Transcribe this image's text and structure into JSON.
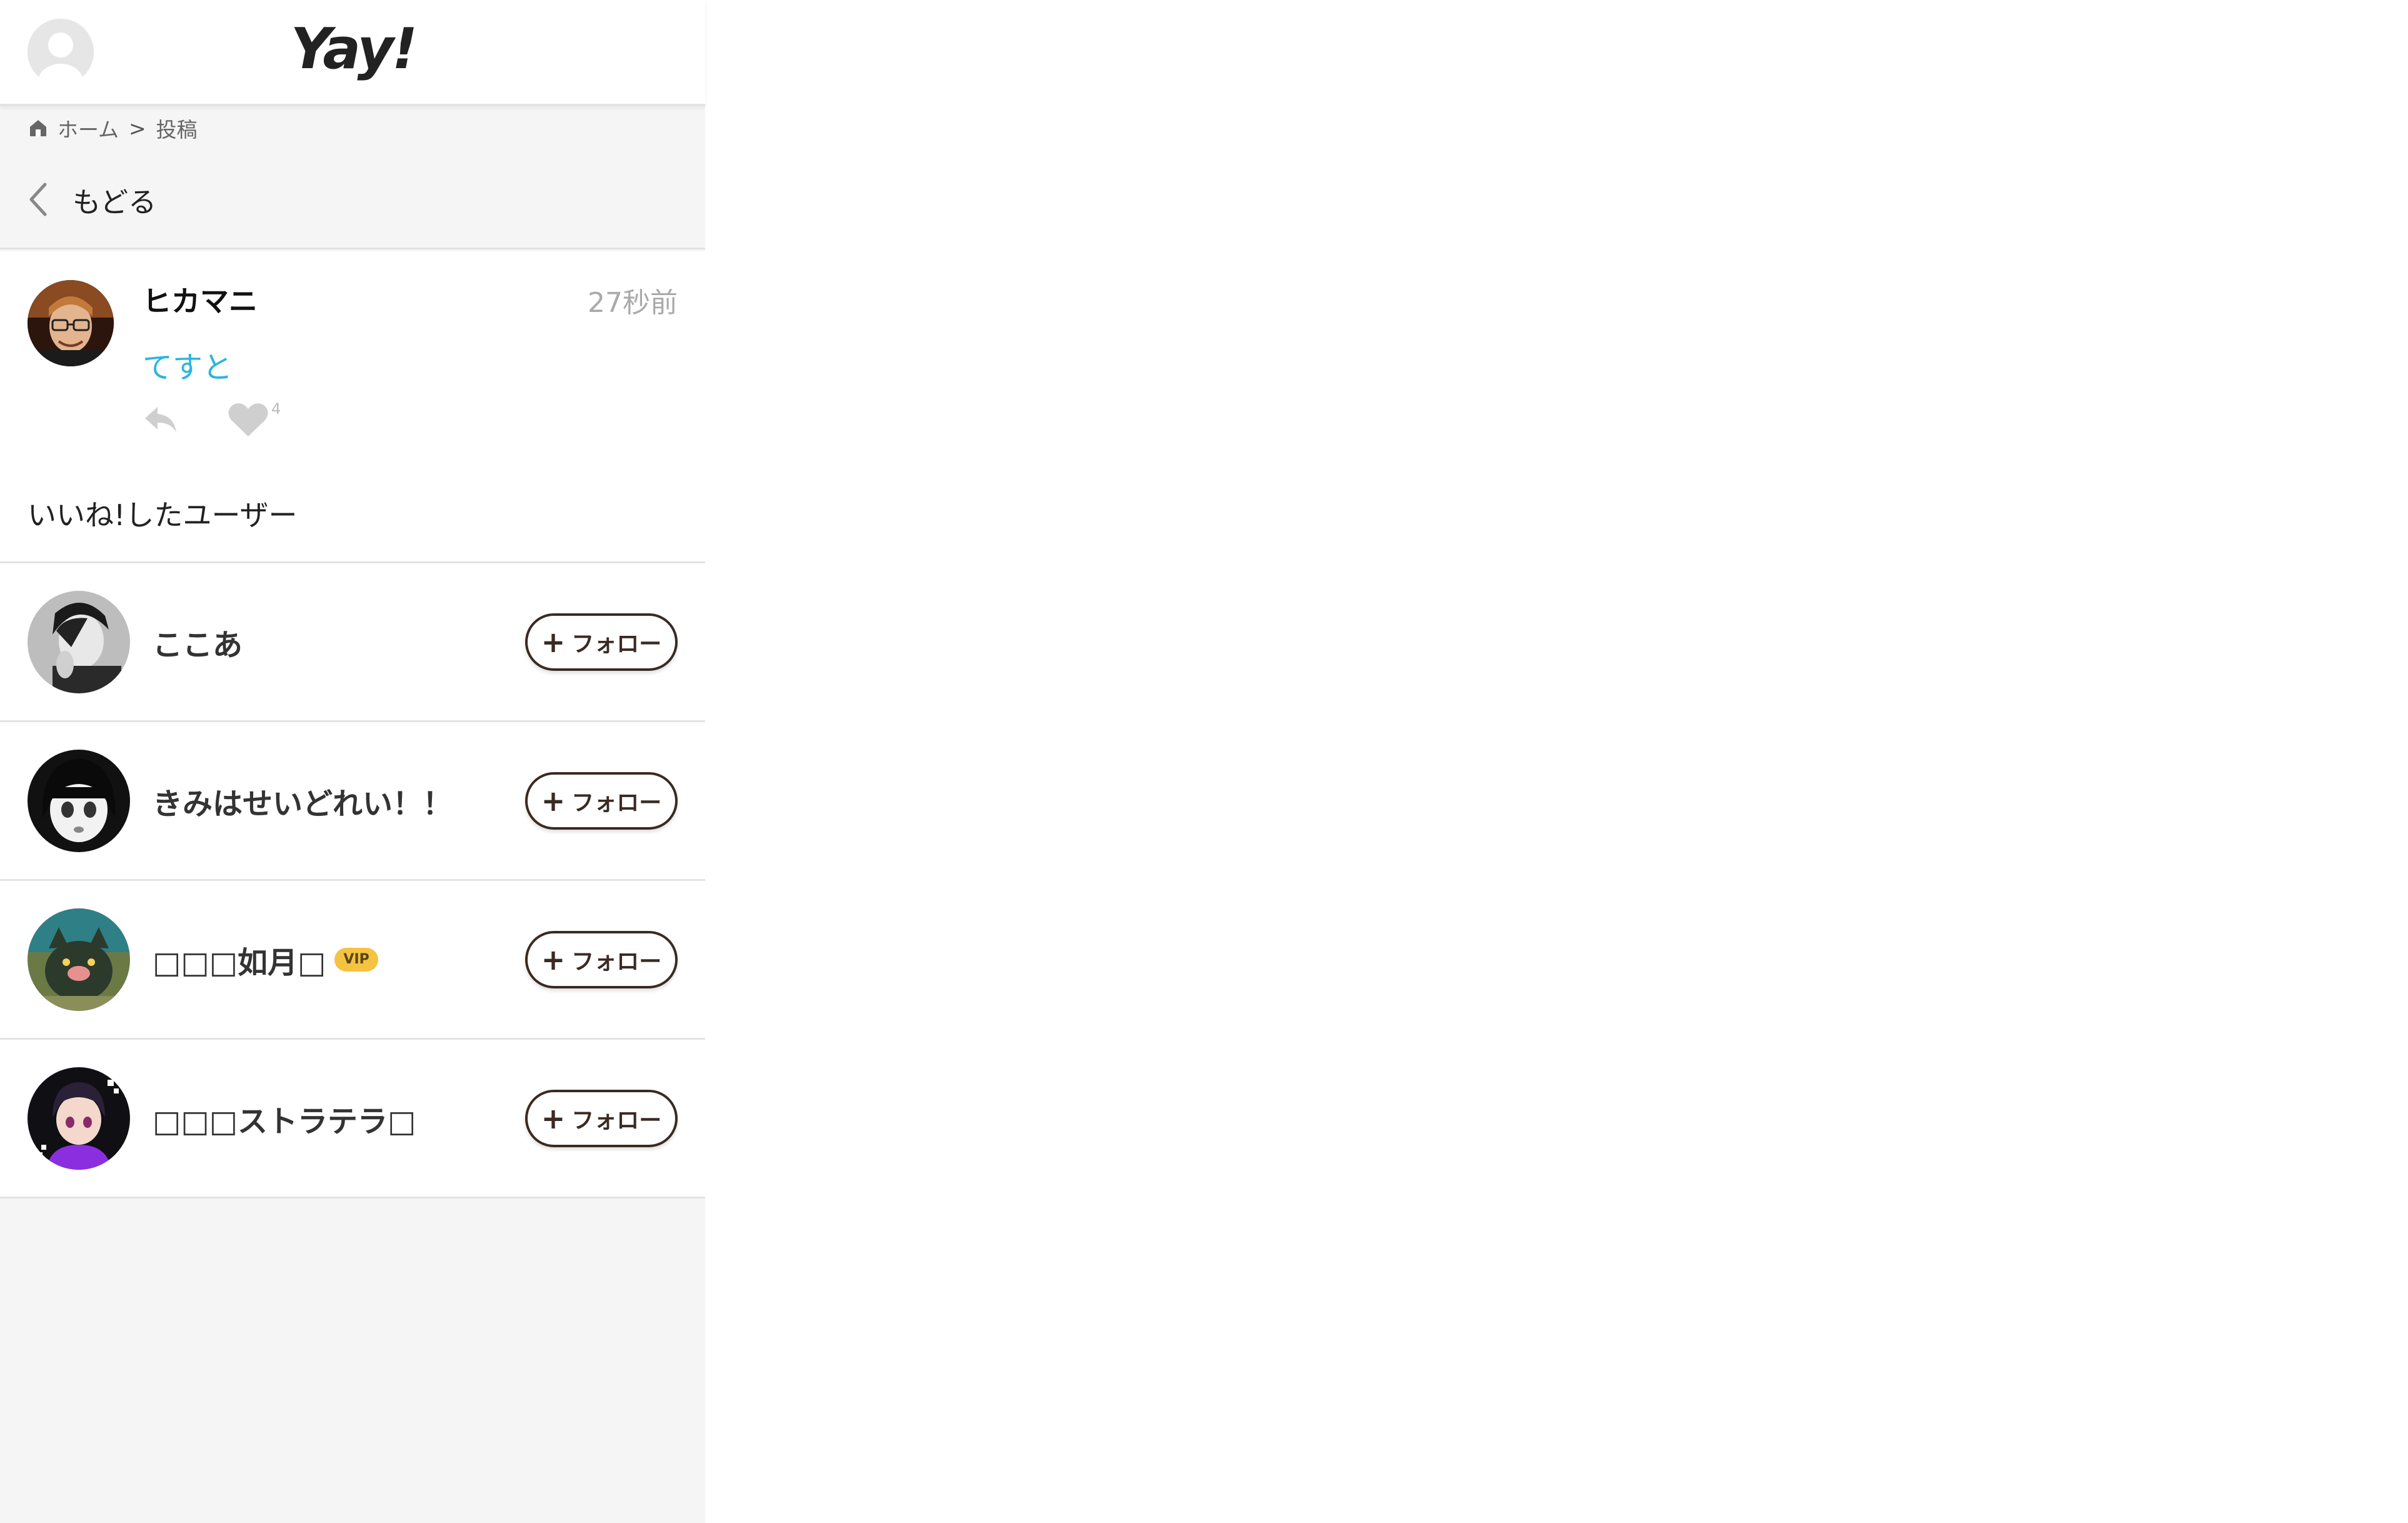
{
  "header": {
    "logo": "Yay!"
  },
  "breadcrumb": {
    "home": "ホーム",
    "separator": ">",
    "current": "投稿"
  },
  "back": {
    "label": "もどる"
  },
  "post": {
    "author": "ヒカマニ",
    "time": "27秒前",
    "text": "てすと",
    "like_count": "4"
  },
  "likes_heading": "いいね!したユーザー",
  "users": [
    {
      "name": "ここあ",
      "follow_label": "フォロー"
    },
    {
      "name": "きみはせいどれい！！",
      "follow_label": "フォロー"
    },
    {
      "name": "□□□如月□",
      "badge": "VIP",
      "follow_label": "フォロー"
    },
    {
      "name": "□□□ストラテラ□",
      "follow_label": "フォロー"
    }
  ],
  "colors": {
    "accent_text": "#2bb5de",
    "follow_border": "#3a2a22",
    "vip_badge": "#f5c342"
  },
  "icons": [
    "avatar-placeholder-icon",
    "home-icon",
    "chevron-left-icon",
    "reply-icon",
    "heart-icon",
    "plus-icon"
  ]
}
